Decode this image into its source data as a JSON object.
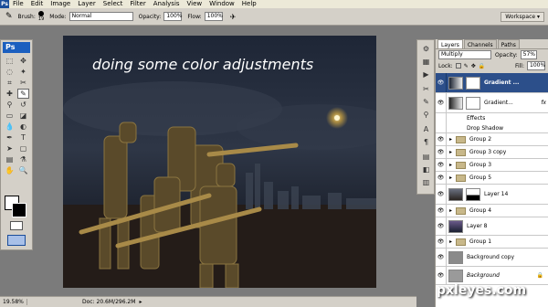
{
  "menu": {
    "logo": "Ps",
    "items": [
      "File",
      "Edit",
      "Image",
      "Layer",
      "Select",
      "Filter",
      "Analysis",
      "View",
      "Window",
      "Help"
    ]
  },
  "options": {
    "brush_label": "Brush:",
    "brush_size": "19",
    "mode_label": "Mode:",
    "mode_value": "Normal",
    "opacity_label": "Opacity:",
    "opacity_value": "100%",
    "flow_label": "Flow:",
    "flow_value": "100%",
    "workspace_label": "Workspace"
  },
  "toolbox": {
    "badge": "Ps"
  },
  "document": {
    "overlay_text": "doing some color adjustments"
  },
  "status": {
    "zoom": "19.58%",
    "doc_info": "Doc: 20.6M/296.2M"
  },
  "layers_panel": {
    "tabs": [
      "Layers",
      "Channels",
      "Paths"
    ],
    "blend_mode": "Multiply",
    "opacity_label": "Opacity:",
    "opacity_value": "57%",
    "lock_label": "Lock:",
    "fill_label": "Fill:",
    "fill_value": "100%",
    "layers": [
      {
        "name": "Gradient ...",
        "type": "adjust"
      },
      {
        "name": "Gradient...",
        "type": "adjust"
      },
      {
        "name": "Effects",
        "type": "effect"
      },
      {
        "name": "Drop Shadow",
        "type": "effect"
      },
      {
        "name": "Group 2",
        "type": "group"
      },
      {
        "name": "Group 3 copy",
        "type": "group"
      },
      {
        "name": "Group 3",
        "type": "group"
      },
      {
        "name": "Group 5",
        "type": "group"
      },
      {
        "name": "Layer 14",
        "type": "layer"
      },
      {
        "name": "Group 4",
        "type": "group"
      },
      {
        "name": "Layer 8",
        "type": "layer"
      },
      {
        "name": "Group 1",
        "type": "group"
      },
      {
        "name": "Background copy",
        "type": "layer"
      },
      {
        "name": "Background",
        "type": "layer"
      }
    ]
  },
  "watermark": "pxleyes.com"
}
